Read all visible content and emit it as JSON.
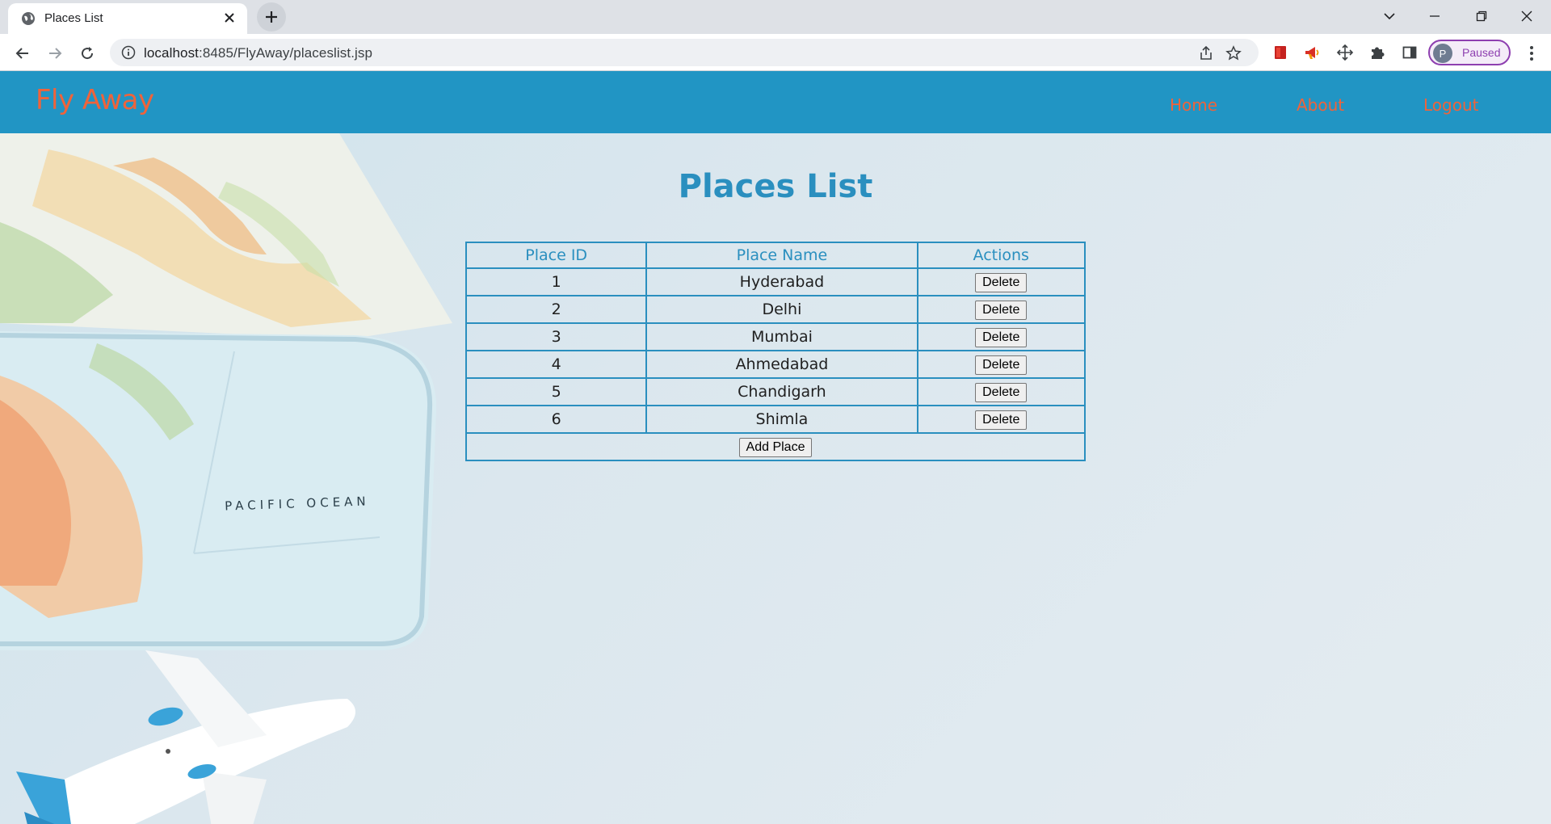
{
  "browser": {
    "tab_title": "Places List",
    "url_host": "localhost",
    "url_rest": ":8485/FlyAway/placeslist.jsp",
    "profile_initial": "P",
    "profile_status": "Paused"
  },
  "header": {
    "brand": "Fly Away",
    "nav": [
      {
        "label": "Home"
      },
      {
        "label": "About"
      },
      {
        "label": "Logout"
      }
    ]
  },
  "main": {
    "title": "Places List",
    "table": {
      "headers": [
        "Place ID",
        "Place Name",
        "Actions"
      ],
      "rows": [
        {
          "id": "1",
          "name": "Hyderabad",
          "action": "Delete"
        },
        {
          "id": "2",
          "name": "Delhi",
          "action": "Delete"
        },
        {
          "id": "3",
          "name": "Mumbai",
          "action": "Delete"
        },
        {
          "id": "4",
          "name": "Ahmedabad",
          "action": "Delete"
        },
        {
          "id": "5",
          "name": "Chandigarh",
          "action": "Delete"
        },
        {
          "id": "6",
          "name": "Shimla",
          "action": "Delete"
        }
      ],
      "add_label": "Add Place"
    }
  },
  "background_art": {
    "map_text": "PACIFIC OCEAN"
  },
  "colors": {
    "header_bg": "#2195c4",
    "accent_orange": "#f0633a",
    "title_blue": "#2a8fbf"
  }
}
